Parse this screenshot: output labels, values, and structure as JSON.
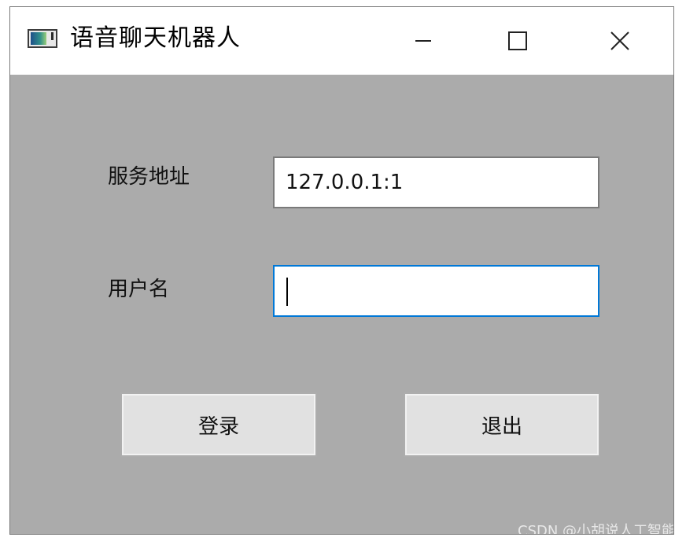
{
  "window": {
    "title": "语音聊天机器人",
    "controls": {
      "minimize": "minimize-icon",
      "maximize": "maximize-icon",
      "close": "close-icon"
    }
  },
  "form": {
    "server_label": "服务地址",
    "server_value": "127.0.0.1:1",
    "username_label": "用户名",
    "username_value": ""
  },
  "buttons": {
    "login_label": "登录",
    "exit_label": "退出"
  },
  "watermark": "CSDN @小胡说人工智能",
  "colors": {
    "client_bg": "#ababab",
    "titlebar_bg": "#ffffff",
    "focus_border": "#0078d7",
    "button_bg": "#e1e1e1"
  }
}
